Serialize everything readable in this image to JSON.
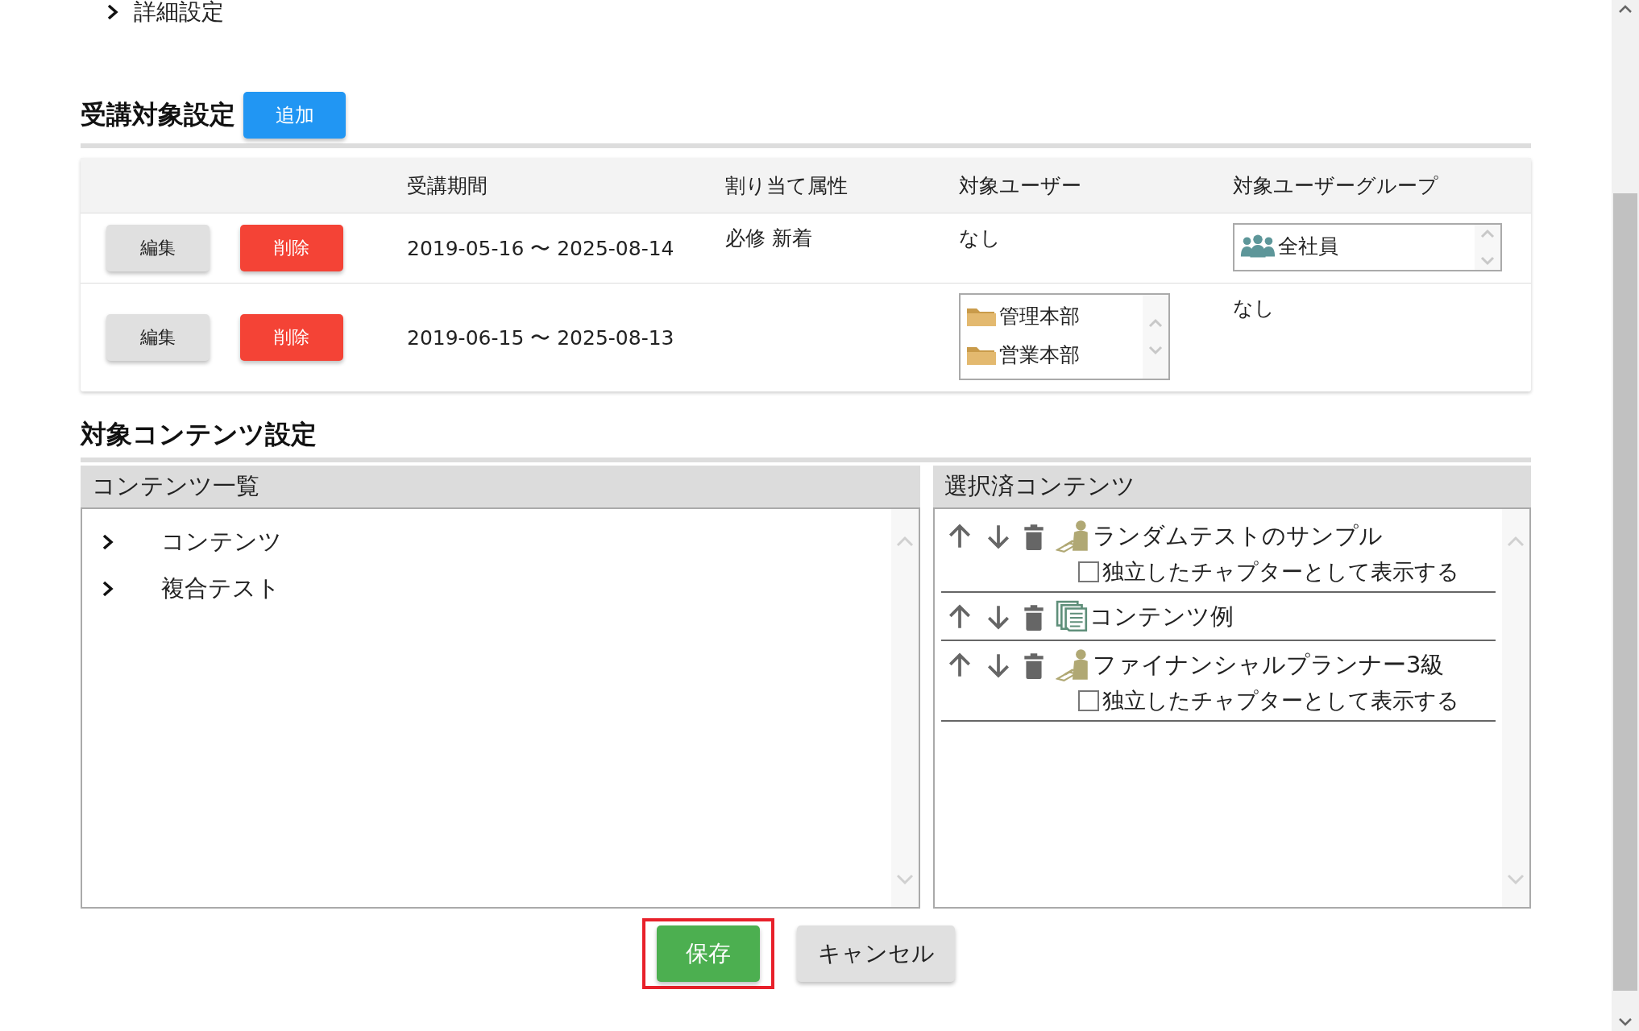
{
  "details_toggle": {
    "label": "詳細設定",
    "expanded": false
  },
  "target_section": {
    "title": "受講対象設定",
    "add_button": "追加",
    "columns": [
      "受講期間",
      "割り当て属性",
      "対象ユーザー",
      "対象ユーザーグループ"
    ],
    "rows": [
      {
        "edit": "編集",
        "delete": "削除",
        "period": "2019-05-16 〜 2025-08-14",
        "attributes": "必修 新着",
        "users": {
          "kind": "text",
          "text": "なし"
        },
        "groups": {
          "kind": "list",
          "items": [
            {
              "kind": "group",
              "label": "全社員"
            }
          ]
        }
      },
      {
        "edit": "編集",
        "delete": "削除",
        "period": "2019-06-15 〜 2025-08-13",
        "attributes": "",
        "users": {
          "kind": "list",
          "items": [
            {
              "kind": "folder",
              "label": "管理本部"
            },
            {
              "kind": "folder",
              "label": "営業本部"
            }
          ]
        },
        "groups": {
          "kind": "text",
          "text": "なし"
        }
      }
    ]
  },
  "content_section": {
    "title": "対象コンテンツ設定",
    "content_list": {
      "title": "コンテンツ一覧",
      "items": [
        {
          "label": "コンテンツ",
          "expanded": false
        },
        {
          "label": "複合テスト",
          "expanded": false
        }
      ]
    },
    "selected_contents": {
      "title": "選択済コンテンツ",
      "items": [
        {
          "kind": "test",
          "label": "ランダムテストのサンプル",
          "option": {
            "label": "独立したチャプターとして表示する",
            "checked": false
          }
        },
        {
          "kind": "content",
          "label": "コンテンツ例"
        },
        {
          "kind": "test",
          "label": "ファイナンシャルプランナー3級",
          "option": {
            "label": "独立したチャプターとして表示する",
            "checked": false
          }
        }
      ]
    }
  },
  "buttons": [
    {
      "kind": "primary",
      "label": "保存",
      "highlighted": true
    },
    {
      "kind": "secondary",
      "label": "キャンセル",
      "highlighted": false
    }
  ]
}
